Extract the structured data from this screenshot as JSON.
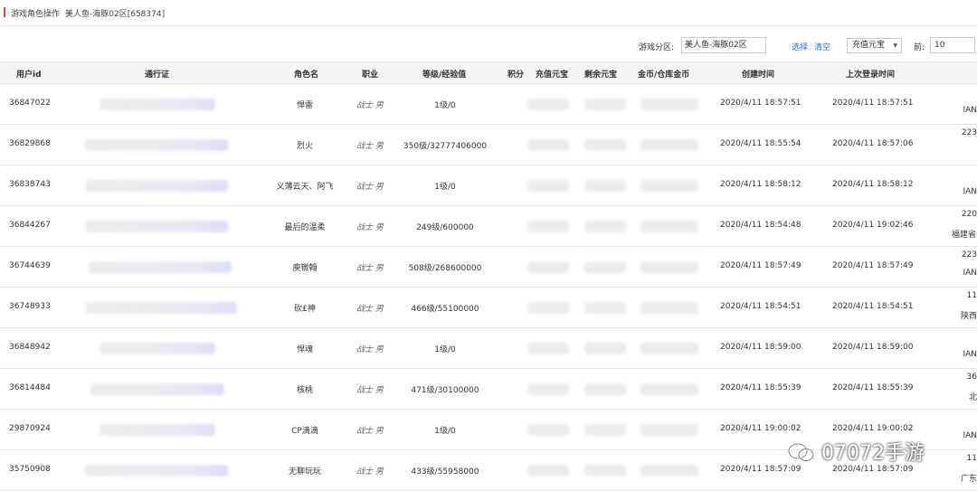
{
  "breadcrumb": {
    "title": "游戏角色操作",
    "server": "美人鱼-海豚02区[658374]"
  },
  "filters": {
    "zone_label": "游戏分区:",
    "zone_value": "美人鱼-海豚02区",
    "select_label": "选择",
    "clear_label": "清空",
    "dropdown_value": "充值元宝",
    "front_label": "前:",
    "front_value": "10"
  },
  "table": {
    "headers": [
      "用户id",
      "通行证",
      "角色名",
      "职业",
      "等级/经验值",
      "积分",
      "充值元宝",
      "剩余元宝",
      "金币/仓库金币",
      "创建时间",
      "上次登录时间"
    ],
    "rows": [
      {
        "id": "36847022",
        "name": "悍雷",
        "job": "战士 男",
        "level": "1级/0",
        "created": "2020/4/11 18:57:51",
        "last_login": "2020/4/11 18:57:51",
        "ip": "",
        "loc": "IAN"
      },
      {
        "id": "36829868",
        "name": "烈火",
        "job": "战士 男",
        "level": "350级/32777406000",
        "created": "2020/4/11 18:55:54",
        "last_login": "2020/4/11 18:57:06",
        "ip": "223",
        "loc": ""
      },
      {
        "id": "36838743",
        "name": "义薄云天、阿飞",
        "job": "战士 男",
        "level": "1级/0",
        "created": "2020/4/11 18:58:12",
        "last_login": "2020/4/11 18:58:12",
        "ip": "",
        "loc": "IAN"
      },
      {
        "id": "36844267",
        "name": "最后的温柔",
        "job": "战士 男",
        "level": "249级/600000",
        "created": "2020/4/11 18:54:48",
        "last_login": "2020/4/11 19:02:46",
        "ip": "220",
        "loc": "福建省号"
      },
      {
        "id": "36744639",
        "name": "庾镦翰",
        "job": "战士 男",
        "level": "508级/268600000",
        "created": "2020/4/11 18:57:49",
        "last_login": "2020/4/11 18:57:49",
        "ip": "223",
        "loc": "IAN"
      },
      {
        "id": "36748933",
        "name": "砍£神",
        "job": "战士 男",
        "level": "466级/55100000",
        "created": "2020/4/11 18:54:51",
        "last_login": "2020/4/11 18:54:51",
        "ip": "11",
        "loc": "陕西"
      },
      {
        "id": "36848942",
        "name": "悍魂",
        "job": "战士 男",
        "level": "1级/0",
        "created": "2020/4/11 18:59:00",
        "last_login": "2020/4/11 18:59:00",
        "ip": "",
        "loc": "IAN"
      },
      {
        "id": "36814484",
        "name": "核桃",
        "job": "战士 男",
        "level": "471级/30100000",
        "created": "2020/4/11 18:55:39",
        "last_login": "2020/4/11 18:55:39",
        "ip": "36",
        "loc": "北"
      },
      {
        "id": "29870924",
        "name": "CP滴滴",
        "job": "战士 男",
        "level": "1级/0",
        "created": "2020/4/11 19:00:02",
        "last_login": "2020/4/11 19:00:02",
        "ip": "",
        "loc": "IAN"
      },
      {
        "id": "35750908",
        "name": "无聊玩玩",
        "job": "战士 男",
        "level": "433级/55958000",
        "created": "2020/4/11 18:57:09",
        "last_login": "2020/4/11 18:57:09",
        "ip": "11",
        "loc": "广东"
      }
    ]
  },
  "watermark": "07072手游"
}
